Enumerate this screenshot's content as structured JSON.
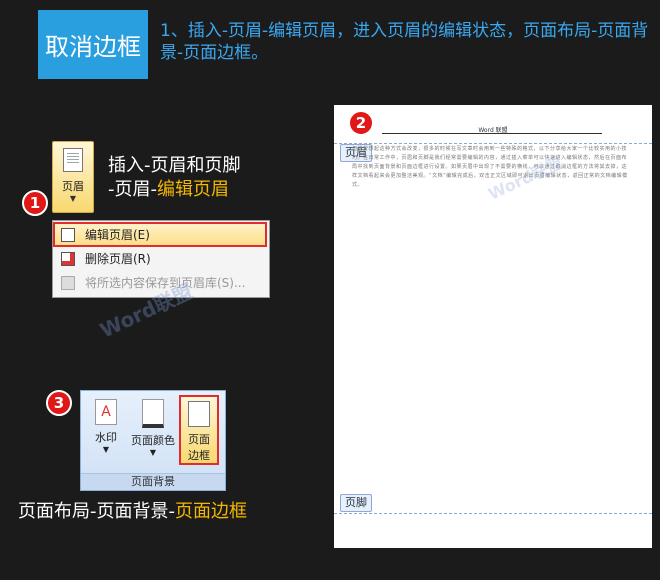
{
  "header": {
    "badge": "取消边框",
    "instruction": "1、插入-页眉-编辑页眉，进入页眉的编辑状态，页面布局-页面背景-页面边框。"
  },
  "step1": {
    "number": "1",
    "ribbon_button_label": "页眉",
    "caption_line1": "插入-页眉和页脚",
    "caption_line2_prefix": "-页眉-",
    "caption_line2_highlight": "编辑页眉",
    "menu_items": [
      {
        "label": "编辑页眉(E)",
        "icon": "edit-header-icon",
        "selected": true
      },
      {
        "label": "删除页眉(R)",
        "icon": "delete-header-icon",
        "selected": false
      },
      {
        "label": "将所选内容保存到页眉库(S)...",
        "icon": "save-to-gallery-icon",
        "disabled": true
      }
    ]
  },
  "step2": {
    "number": "2",
    "document_header_text": "Word 联盟",
    "header_tag": "页眉",
    "footer_tag": "页脚",
    "body_text": "但谁曾想起这种方式会改变，很多的时候在写文章时会用到一些特殊的格式，以下分享给大家一个比较实用的小技巧。在日常工作中，页眉和页脚是我们经常需要编辑的内容，通过插入菜单可以快速进入编辑状态，然后在页面布局中找到页面背景和页面边框进行设置。如果页眉中出现了不需要的横线，可以通过取消边框的方法将其去掉，这样文档看起来会更加整洁美观。“文档”编辑完成后，双击正文区域即可退出页眉编辑状态，返回正常的文档编辑模式。"
  },
  "step3": {
    "number": "3",
    "buttons": [
      {
        "label": "水印",
        "icon": "watermark-icon"
      },
      {
        "label": "页面颜色",
        "icon": "page-color-icon"
      },
      {
        "label_line1": "页面",
        "label_line2": "边框",
        "icon": "page-border-icon"
      }
    ],
    "group_label": "页面背景",
    "caption_prefix": "页面布局-页面背景-",
    "caption_highlight": "页面边框"
  },
  "watermark_text": "Word联盟",
  "colors": {
    "accent_blue": "#2a9fe0",
    "highlight_orange": "#f5b800",
    "step_red": "#e01818"
  }
}
